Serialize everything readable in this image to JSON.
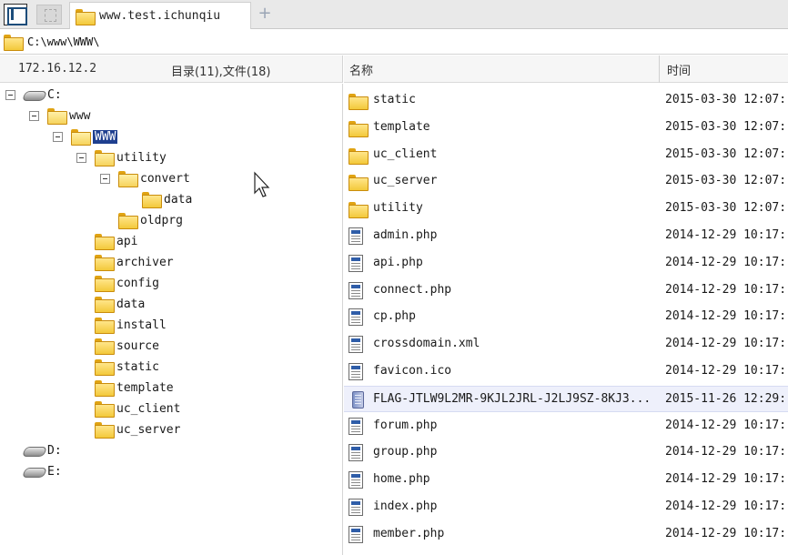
{
  "tab": {
    "title": "www.test.ichunqiu",
    "add_label": "+"
  },
  "address": {
    "path": "C:\\www\\WWW\\"
  },
  "left_header": {
    "ip": "172.16.12.2",
    "count": "目录(11),文件(18)"
  },
  "list_header": {
    "name": "名称",
    "time": "时间"
  },
  "tree": {
    "c": "C:",
    "www": "www",
    "WWW": "WWW",
    "utility": "utility",
    "convert": "convert",
    "data_sub": "data",
    "oldprg": "oldprg",
    "api": "api",
    "archiver": "archiver",
    "config": "config",
    "data": "data",
    "install": "install",
    "source": "source",
    "static": "static",
    "template": "template",
    "uc_client": "uc_client",
    "uc_server": "uc_server",
    "d": "D:",
    "e": "E:"
  },
  "files": [
    {
      "name": "static",
      "time": "2015-03-30 12:07:",
      "type": "folder"
    },
    {
      "name": "template",
      "time": "2015-03-30 12:07:",
      "type": "folder"
    },
    {
      "name": "uc_client",
      "time": "2015-03-30 12:07:",
      "type": "folder"
    },
    {
      "name": "uc_server",
      "time": "2015-03-30 12:07:",
      "type": "folder"
    },
    {
      "name": "utility",
      "time": "2015-03-30 12:07:",
      "type": "folder"
    },
    {
      "name": "admin.php",
      "time": "2014-12-29 10:17:",
      "type": "file"
    },
    {
      "name": "api.php",
      "time": "2014-12-29 10:17:",
      "type": "file"
    },
    {
      "name": "connect.php",
      "time": "2014-12-29 10:17:",
      "type": "file"
    },
    {
      "name": "cp.php",
      "time": "2014-12-29 10:17:",
      "type": "file"
    },
    {
      "name": "crossdomain.xml",
      "time": "2014-12-29 10:17:",
      "type": "file"
    },
    {
      "name": "favicon.ico",
      "time": "2014-12-29 10:17:",
      "type": "file"
    },
    {
      "name": "FLAG-JTLW9L2MR-9KJL2JRL-J2LJ9SZ-8KJ3...",
      "time": "2015-11-26 12:29:",
      "type": "text"
    },
    {
      "name": "forum.php",
      "time": "2014-12-29 10:17:",
      "type": "file"
    },
    {
      "name": "group.php",
      "time": "2014-12-29 10:17:",
      "type": "file"
    },
    {
      "name": "home.php",
      "time": "2014-12-29 10:17:",
      "type": "file"
    },
    {
      "name": "index.php",
      "time": "2014-12-29 10:17:",
      "type": "file"
    },
    {
      "name": "member.php",
      "time": "2014-12-29 10:17:",
      "type": "file"
    }
  ],
  "colors": {
    "selection": "#1f3f8f",
    "highlight_row": "#eef0fb",
    "folder": "#f3c93a"
  }
}
